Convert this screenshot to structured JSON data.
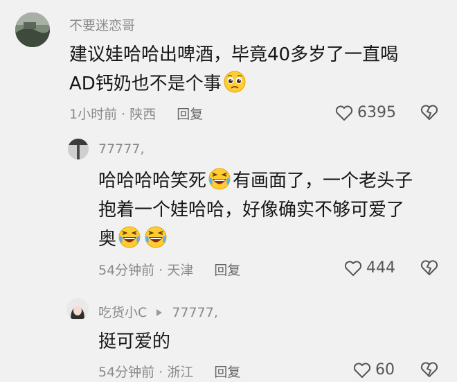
{
  "comments": [
    {
      "username": "不要迷恋哥",
      "text_line1": "建议娃哈哈出啤酒，毕竟40多岁了一直喝",
      "text_line2": "AD钙奶也不是个事",
      "time": "1小时前",
      "location": "陕西",
      "reply_label": "回复",
      "likes": "6395"
    },
    {
      "username": "77777,",
      "text_line1_a": "哈哈哈哈笑死",
      "text_line1_b": "有画面了，一个老头子",
      "text_line2": "抱着一个娃哈哈，好像确实不够可爱了",
      "text_line3": "奥",
      "time": "54分钟前",
      "location": "天津",
      "reply_label": "回复",
      "likes": "444"
    },
    {
      "username": "吃货小C",
      "reply_to": "77777,",
      "text": "挺可爱的",
      "time": "54分钟前",
      "location": "浙江",
      "reply_label": "回复",
      "likes": "60"
    }
  ],
  "icons": {
    "like": "heart-outline-icon",
    "dislike": "broken-heart-icon",
    "reply_arrow": "triangle-right-icon",
    "emoji_pleading": "pleading-face-emoji",
    "emoji_laughing": "laughing-tears-emoji"
  },
  "colors": {
    "background": "#f1f1f1",
    "text_primary": "#161616",
    "text_secondary": "#8a8a8a"
  }
}
